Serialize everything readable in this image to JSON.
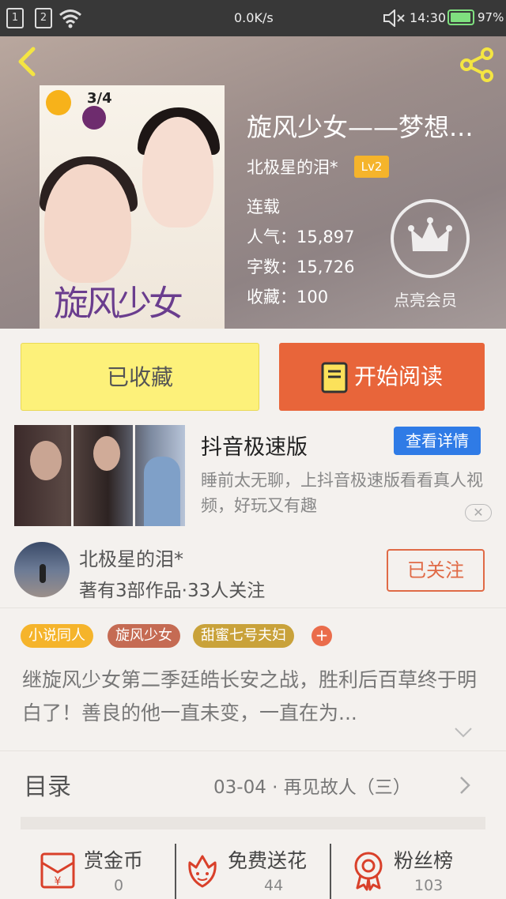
{
  "status_bar": {
    "sim1": "1",
    "sim2": "2",
    "speed": "0.0K/s",
    "time": "14:30",
    "battery": "97%",
    "battery_level": 0.97
  },
  "book": {
    "title": "旋风少女——梦想...",
    "author": "北极星的泪*",
    "level": "Lv2",
    "status": "连载",
    "popularity": "人气：15,897",
    "word_count": "字数：15,726",
    "favorites": "收藏：100",
    "vip_label": "点亮会员"
  },
  "cover": {
    "date": "3/4",
    "logo": "旋风少女"
  },
  "actions": {
    "collected": "已收藏",
    "read": "开始阅读"
  },
  "ad": {
    "title": "抖音极速版",
    "button": "查看详情",
    "description": "睡前太无聊，上抖音极速版看看真人视频，好玩又有趣",
    "close": "✕"
  },
  "author_info": {
    "name": "北极星的泪*",
    "stats": "著有3部作品·33人关注",
    "follow": "已关注"
  },
  "tags": [
    {
      "label": "小说同人",
      "color": "#f5b42b"
    },
    {
      "label": "旋风少女",
      "color": "#c56b53"
    },
    {
      "label": "甜蜜七号夫妇",
      "color": "#c9a23a"
    }
  ],
  "tag_add": "+",
  "description": "继旋风少女第二季廷皓长安之战，胜利后百草终于明白了！善良的他一直未变，一直在为...",
  "toc": {
    "label": "目录",
    "latest": "03-04 · 再见故人（三）"
  },
  "bottom_bar": [
    {
      "label": "赏金币",
      "value": "0"
    },
    {
      "label": "免费送花",
      "value": "44"
    },
    {
      "label": "粉丝榜",
      "value": "103"
    }
  ],
  "colors": {
    "accent": "#e8653a",
    "collected": "#fdf17a",
    "ad_button": "#2f7be6",
    "level": "#f5b42b"
  }
}
